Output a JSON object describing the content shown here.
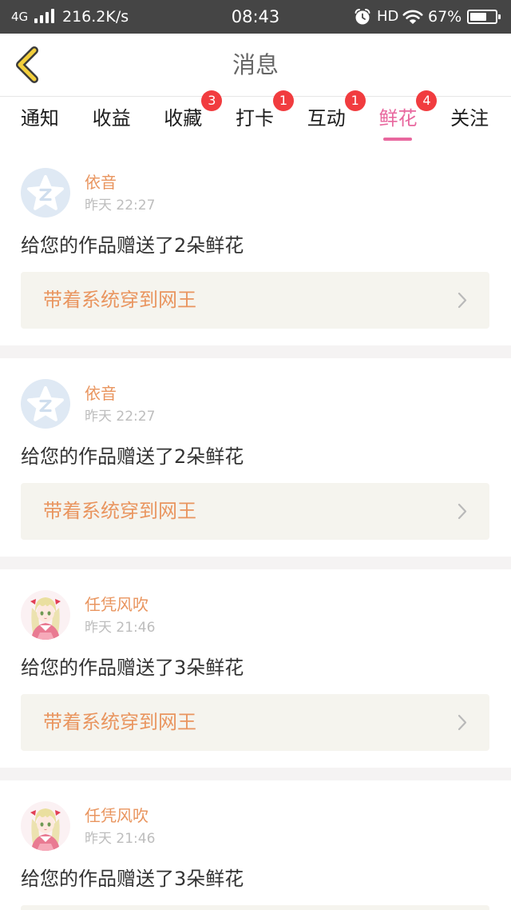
{
  "status_bar": {
    "network": "4G",
    "signal_bars": 4,
    "speed": "216.2K/s",
    "time": "08:43",
    "alarm_icon": "alarm-clock-icon",
    "hd": "HD",
    "wifi_icon": "wifi-icon",
    "battery_text": "67%",
    "battery_level": 0.67,
    "battery_icon": "battery-icon"
  },
  "header": {
    "back_icon": "back-chevron-icon",
    "title": "消息"
  },
  "tabs": [
    {
      "label": "通知"
    },
    {
      "label": "收益"
    },
    {
      "label": "收藏",
      "badge": "3"
    },
    {
      "label": "打卡",
      "badge": "1"
    },
    {
      "label": "互动",
      "badge": "1"
    },
    {
      "label": "鲜花",
      "badge": "4",
      "active": true
    },
    {
      "label": "关注"
    }
  ],
  "messages": [
    {
      "avatar_icon": "default-avatar-icon",
      "name": "依音",
      "time": "昨天 22:27",
      "text": "给您的作品赠送了2朵鲜花",
      "book_title": "带着系统穿到网王",
      "link_icon": "chevron-right-icon"
    },
    {
      "avatar_icon": "default-avatar-icon",
      "name": "依音",
      "time": "昨天 22:27",
      "text": "给您的作品赠送了2朵鲜花",
      "book_title": "带着系统穿到网王",
      "link_icon": "chevron-right-icon"
    },
    {
      "avatar_icon": "anime-girl-avatar-icon",
      "name": "任凭风吹",
      "time": "昨天 21:46",
      "text": "给您的作品赠送了3朵鲜花",
      "book_title": "带着系统穿到网王",
      "link_icon": "chevron-right-icon"
    },
    {
      "avatar_icon": "anime-girl-avatar-icon",
      "name": "任凭风吹",
      "time": "昨天 21:46",
      "text": "给您的作品赠送了3朵鲜花"
    }
  ],
  "colors": {
    "status_bar_bg": "#454545",
    "accent_pink": "#e8679e",
    "badge_red": "#f13c3f",
    "accent_orange": "#e9955f",
    "book_bg": "#f5f4ee",
    "separator": "#f5f3f3"
  }
}
